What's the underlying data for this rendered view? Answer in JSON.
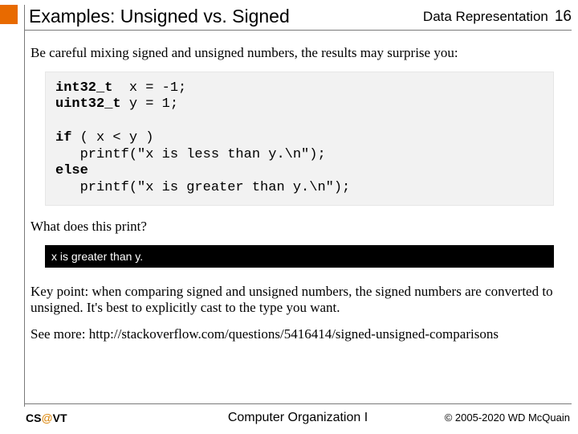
{
  "header": {
    "title": "Examples: Unsigned vs. Signed",
    "topic": "Data Representation",
    "page": "16"
  },
  "body": {
    "intro": "Be careful mixing signed and unsigned numbers, the results may surprise you:",
    "code": {
      "l1a": "int32_t",
      "l1b": "  x = -1;",
      "l2a": "uint32_t",
      "l2b": " y = 1;",
      "l3": "",
      "l4a": "if",
      "l4b": " ( x < y )",
      "l5": "   printf(\"x is less than y.\\n\");",
      "l6a": "else",
      "l7": "   printf(\"x is greater than y.\\n\");"
    },
    "question": "What does this print?",
    "output": "x is greater than y.",
    "keypoint": "Key point: when comparing signed and unsigned numbers, the signed numbers are converted to unsigned. It's best to explicitly cast to the type you want.",
    "seemore": "See more: http://stackoverflow.com/questions/5416414/signed-unsigned-comparisons"
  },
  "footer": {
    "left_pre": "CS",
    "left_at": "@",
    "left_post": "VT",
    "center": "Computer Organization I",
    "right": "© 2005-2020  WD McQuain"
  }
}
